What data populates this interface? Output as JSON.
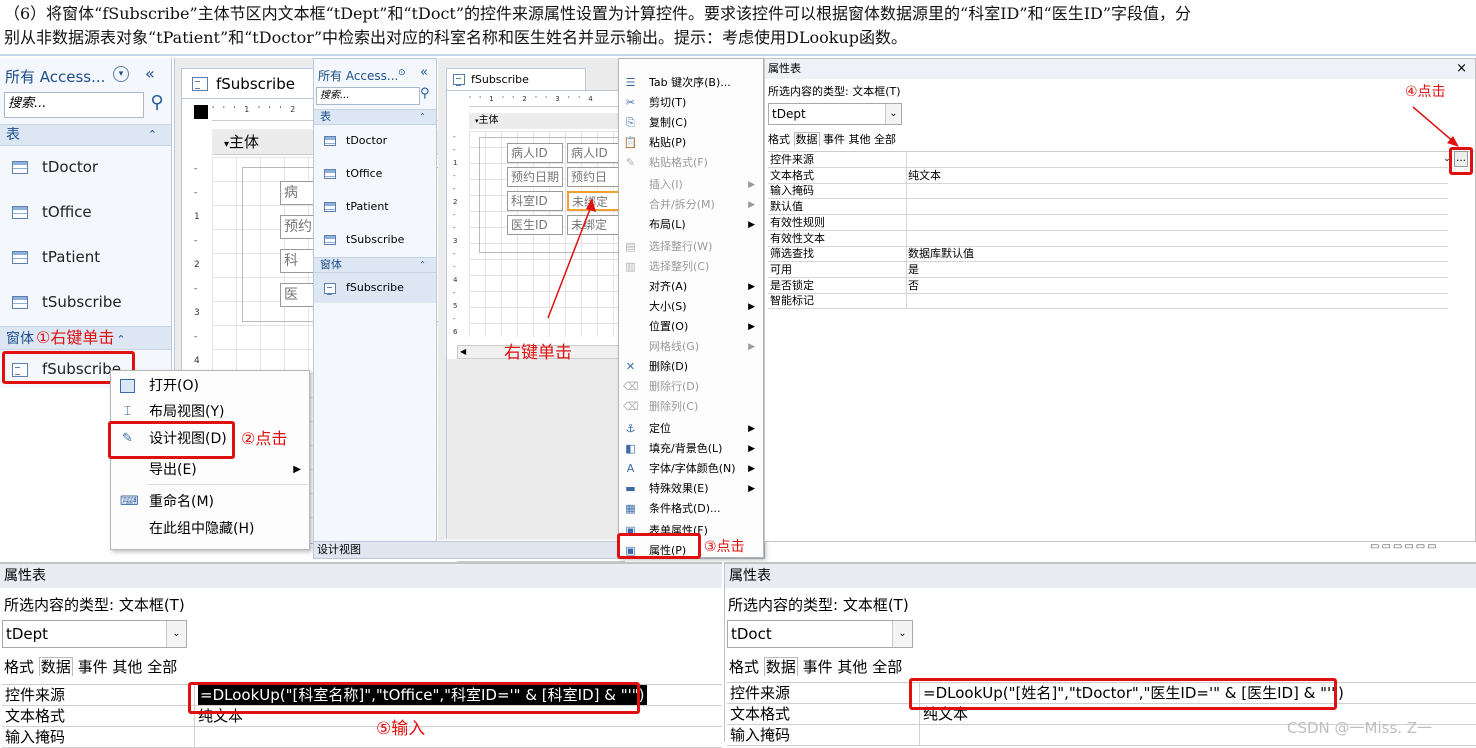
{
  "instruction": {
    "line1": "（6）将窗体“fSubscribe”主体节区内文本框“tDept”和“tDoct”的控件来源属性设置为计算控件。要求该控件可以根据窗体数据源里的“科室ID”和“医生ID”字段值，分",
    "line2": "别从非数据源表对象“tPatient”和“tDoctor”中检索出对应的科室名称和医生姓名并显示输出。提示：考虑使用DLookup函数。"
  },
  "nav1": {
    "title": "所有 Access...",
    "search_placeholder": "搜索...",
    "group_tables": "表",
    "tables": [
      "tDoctor",
      "tOffice",
      "tPatient",
      "tSubscribe"
    ],
    "group_forms": "窗体",
    "forms": [
      "fSubscribe"
    ],
    "callout": "①右键单击"
  },
  "design1": {
    "tab": "fSubscribe",
    "section": "主体",
    "ctrl_labels": [
      "病",
      "预约",
      "科",
      "医"
    ]
  },
  "menu1": {
    "items": [
      {
        "label": "打开(O)",
        "icon": "open-icon"
      },
      {
        "label": "布局视图(Y)",
        "icon": "layout-view-icon"
      },
      {
        "label": "设计视图(D)",
        "icon": "design-view-icon"
      },
      {
        "label": "导出(E)",
        "icon": "export-icon"
      },
      {
        "label": "重命名(M)",
        "icon": "rename-icon"
      },
      {
        "label": "在此组中隐藏(H)",
        "icon": ""
      }
    ],
    "callout": "②点击"
  },
  "nav2": {
    "title": "所有 Access...",
    "search_placeholder": "搜索...",
    "group_tables": "表",
    "tables": [
      "tDoctor",
      "tOffice",
      "tPatient",
      "tSubscribe"
    ],
    "group_forms": "窗体",
    "forms": [
      "fSubscribe"
    ],
    "statusbar": "设计视图"
  },
  "design2": {
    "tab": "fSubscribe",
    "section": "主体",
    "labels": [
      "病人ID",
      "预约日期",
      "科室ID",
      "医生ID"
    ],
    "boxes": [
      "病人ID",
      "预约日",
      "未绑定",
      "未绑定"
    ],
    "callout": "右键单击"
  },
  "menu2": {
    "items": [
      {
        "label": "Tab 键次序(B)...",
        "icon": "tab-order-icon",
        "sub": false,
        "dim": false
      },
      {
        "label": "剪切(T)",
        "icon": "cut-icon",
        "sub": false,
        "dim": false
      },
      {
        "label": "复制(C)",
        "icon": "copy-icon",
        "sub": false,
        "dim": false
      },
      {
        "label": "粘贴(P)",
        "icon": "paste-icon",
        "sub": false,
        "dim": false
      },
      {
        "label": "粘贴格式(F)",
        "icon": "format-painter-icon",
        "sub": false,
        "dim": true
      },
      {
        "label": "插入(I)",
        "icon": "",
        "sub": true,
        "dim": true
      },
      {
        "label": "合并/拆分(M)",
        "icon": "",
        "sub": true,
        "dim": true
      },
      {
        "label": "布局(L)",
        "icon": "",
        "sub": true,
        "dim": false
      },
      {
        "label": "选择整行(W)",
        "icon": "select-row-icon",
        "sub": false,
        "dim": true
      },
      {
        "label": "选择整列(C)",
        "icon": "select-column-icon",
        "sub": false,
        "dim": true
      },
      {
        "label": "对齐(A)",
        "icon": "",
        "sub": true,
        "dim": false
      },
      {
        "label": "大小(S)",
        "icon": "",
        "sub": true,
        "dim": false
      },
      {
        "label": "位置(O)",
        "icon": "",
        "sub": true,
        "dim": false
      },
      {
        "label": "网格线(G)",
        "icon": "",
        "sub": true,
        "dim": true
      },
      {
        "label": "删除(D)",
        "icon": "delete-icon",
        "sub": false,
        "dim": false
      },
      {
        "label": "删除行(D)",
        "icon": "delete-row-icon",
        "sub": false,
        "dim": true
      },
      {
        "label": "删除列(C)",
        "icon": "delete-column-icon",
        "sub": false,
        "dim": true
      },
      {
        "label": "定位",
        "icon": "anchor-icon",
        "sub": true,
        "dim": false
      },
      {
        "label": "填充/背景色(L)",
        "icon": "fill-color-icon",
        "sub": true,
        "dim": false
      },
      {
        "label": "字体/字体颜色(N)",
        "icon": "font-color-icon",
        "sub": true,
        "dim": false
      },
      {
        "label": "特殊效果(E)",
        "icon": "special-effect-icon",
        "sub": true,
        "dim": false
      },
      {
        "label": "条件格式(D)...",
        "icon": "conditional-format-icon",
        "sub": false,
        "dim": false
      },
      {
        "label": "表单属性(F)",
        "icon": "form-properties-icon",
        "sub": false,
        "dim": false
      },
      {
        "label": "属性(P)",
        "icon": "properties-icon",
        "sub": false,
        "dim": false
      }
    ],
    "callout": "③点击"
  },
  "ps_top": {
    "title": "属性表",
    "close": "×",
    "type_label": "所选内容的类型: 文本框(T)",
    "object": "tDept",
    "tabs": [
      "格式",
      "数据",
      "事件",
      "其他",
      "全部"
    ],
    "rows": [
      [
        "控件来源",
        ""
      ],
      [
        "文本格式",
        "纯文本"
      ],
      [
        "输入掩码",
        ""
      ],
      [
        "默认值",
        ""
      ],
      [
        "有效性规则",
        ""
      ],
      [
        "有效性文本",
        ""
      ],
      [
        "筛选查找",
        "数据库默认值"
      ],
      [
        "可用",
        "是"
      ],
      [
        "是否锁定",
        "否"
      ],
      [
        "智能标记",
        ""
      ]
    ],
    "builder": "…",
    "callout": "④点击"
  },
  "ps_left": {
    "title": "属性表",
    "type_label": "所选内容的类型: 文本框(T)",
    "object": "tDept",
    "tabs": [
      "格式",
      "数据",
      "事件",
      "其他",
      "全部"
    ],
    "rows": [
      [
        "控件来源",
        "=DLookUp(\"[科室名称]\",\"tOffice\",\"科室ID='\" & [科室ID] & \"'\")"
      ],
      [
        "文本格式",
        "纯文本"
      ],
      [
        "输入掩码",
        ""
      ]
    ],
    "callout": "⑤输入"
  },
  "ps_right": {
    "title": "属性表",
    "type_label": "所选内容的类型: 文本框(T)",
    "object": "tDoct",
    "tabs": [
      "格式",
      "数据",
      "事件",
      "其他",
      "全部"
    ],
    "rows": [
      [
        "控件来源",
        "=DLookUp(\"[姓名]\",\"tDoctor\",\"医生ID='\" & [医生ID] & \"'\")"
      ],
      [
        "文本格式",
        "纯文本"
      ],
      [
        "输入掩码",
        ""
      ]
    ]
  },
  "watermark": "CSDN @一Miss. Z一",
  "colors": {
    "accent": "#1e4e8c",
    "callout": "#e01010"
  }
}
